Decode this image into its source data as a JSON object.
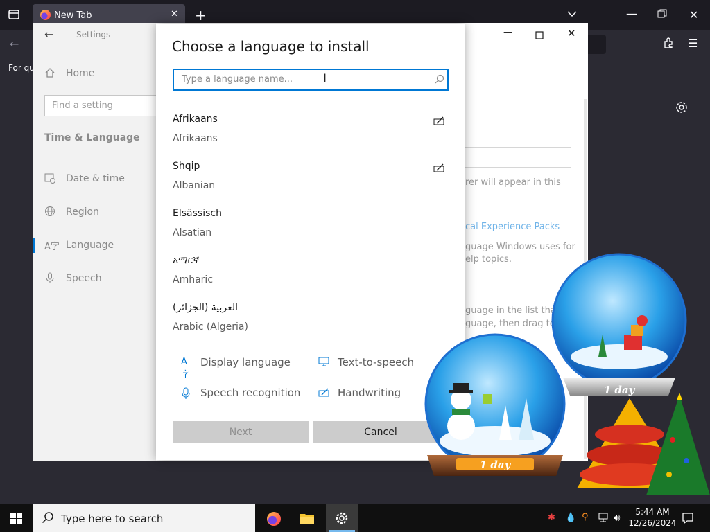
{
  "browser": {
    "tab_title": "New Tab",
    "bookmark_text": "For qu"
  },
  "settings": {
    "title": "Settings",
    "home": "Home",
    "find_placeholder": "Find a setting",
    "section": "Time & Language",
    "nav": [
      {
        "label": "Date & time",
        "icon": "calendar-clock-icon"
      },
      {
        "label": "Region",
        "icon": "globe-icon"
      },
      {
        "label": "Language",
        "icon": "language-icon"
      },
      {
        "label": "Speech",
        "icon": "microphone-icon"
      }
    ],
    "bg_text": {
      "line1": "rer will appear in this",
      "link": "cal Experience Packs",
      "line2": "guage Windows uses for",
      "line3": "elp topics.",
      "line4": "guage in the list that",
      "line5": "guage, then drag to"
    }
  },
  "dialog": {
    "title": "Choose a language to install",
    "search_placeholder": "Type a language name...",
    "languages": [
      {
        "native": "Afrikaans",
        "english": "Afrikaans",
        "handwriting": true
      },
      {
        "native": "Shqip",
        "english": "Albanian",
        "handwriting": true
      },
      {
        "native": "Elsässisch",
        "english": "Alsatian",
        "handwriting": false
      },
      {
        "native": "አማርኛ",
        "english": "Amharic",
        "handwriting": false
      },
      {
        "native": "العربية (الجزائر)",
        "english": "Arabic (Algeria)",
        "handwriting": false
      }
    ],
    "features": {
      "display_language": "Display language",
      "text_to_speech": "Text-to-speech",
      "speech_recognition": "Speech recognition",
      "handwriting": "Handwriting"
    },
    "next_label": "Next",
    "cancel_label": "Cancel"
  },
  "taskbar": {
    "search_text": "Type here to search",
    "time": "5:44 AM",
    "date": "12/26/2024"
  },
  "overlay": {
    "globe_label": "1 day"
  },
  "colors": {
    "accent": "#0078d4",
    "taskbar": "#101010",
    "browser_bg": "#2b2a33"
  }
}
